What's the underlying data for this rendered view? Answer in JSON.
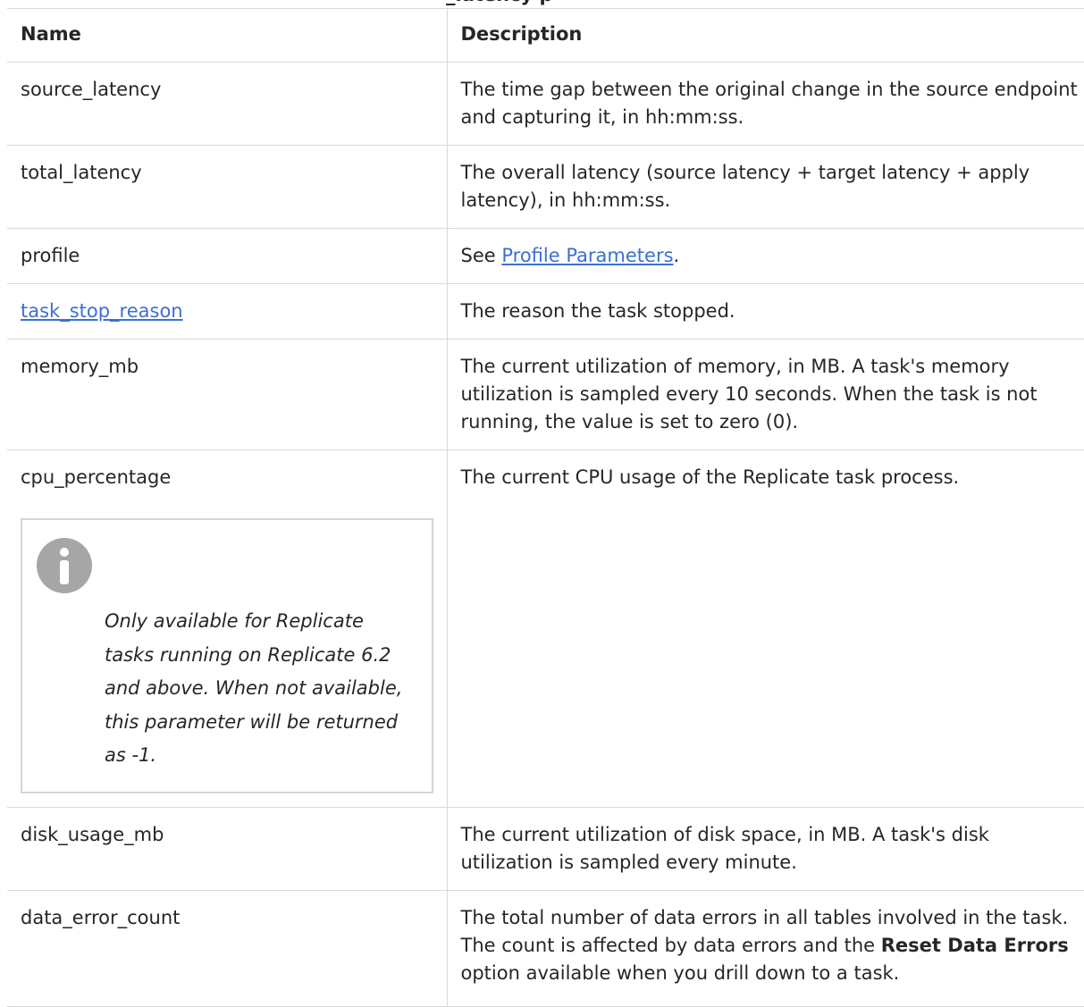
{
  "caption_fragment": "_latency p",
  "table": {
    "headers": {
      "name": "Name",
      "description": "Description"
    },
    "rows": [
      {
        "name": "source_latency",
        "description": "The time gap between the original change in the source endpoint and capturing it, in hh:mm:ss."
      },
      {
        "name": "total_latency",
        "description": "The overall latency (source latency + target latency + apply latency), in hh:mm:ss."
      },
      {
        "name": "profile",
        "description_prefix": "See ",
        "description_link": "Profile Parameters",
        "description_suffix": "."
      },
      {
        "name": "task_stop_reason",
        "description": "The reason the task stopped."
      },
      {
        "name": "memory_mb",
        "description": "The current utilization of memory, in MB. A task's memory utilization is sampled every 10 seconds. When the task is not running, the value is set to zero (0)."
      },
      {
        "name": "cpu_percentage",
        "note": "Only available for Replicate tasks running on Replicate 6.2 and above. When not available, this parameter will be returned as -1.",
        "note_icon": "info-icon",
        "description": "The current CPU usage of the Replicate task process."
      },
      {
        "name": "disk_usage_mb",
        "description": "The current utilization of disk space, in MB. A task's disk utilization is sampled every minute."
      },
      {
        "name": "data_error_count",
        "description_prefix": "The total number of data errors in all tables involved in the task. The count is affected by data errors and the ",
        "description_bold": "Reset Data Errors",
        "description_suffix": " option available when you drill down to a task."
      }
    ]
  },
  "colors": {
    "text": "#262626",
    "link": "#3b6fd6",
    "border": "#d9d9d9",
    "icon": "#a6a6a6"
  }
}
